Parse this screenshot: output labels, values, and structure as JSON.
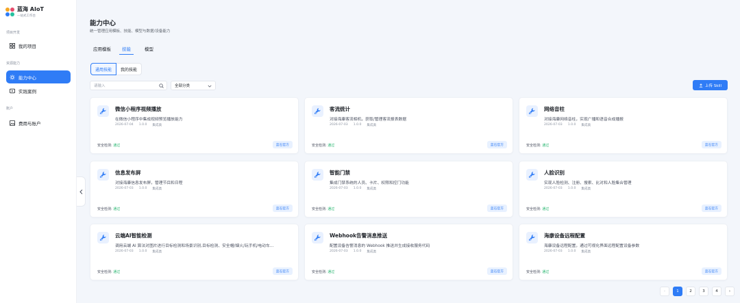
{
  "brand": {
    "name": "蓝海 AIoT",
    "subtitle": "一站式工作台"
  },
  "sidebar": {
    "groups": [
      {
        "title": "项目开发",
        "items": [
          {
            "label": "我的项目",
            "icon": "grid-icon"
          }
        ]
      },
      {
        "title": "资源能力",
        "items": [
          {
            "label": "能力中心",
            "icon": "gear-icon",
            "active": true
          },
          {
            "label": "实践案例",
            "icon": "play-icon"
          }
        ]
      },
      {
        "title": "账户",
        "items": [
          {
            "label": "费用与账户",
            "icon": "image-icon"
          }
        ]
      }
    ]
  },
  "page": {
    "title": "能力中心",
    "subtitle": "统一管理应用模板、技能、模型与数据/设备能力"
  },
  "tabs": [
    {
      "label": "应用模板"
    },
    {
      "label": "技能",
      "active": true
    },
    {
      "label": "模型"
    }
  ],
  "segments": [
    {
      "label": "通用技能",
      "active": true
    },
    {
      "label": "我的技能"
    }
  ],
  "filters": {
    "search_placeholder": "请输入",
    "category_value": "全部分类"
  },
  "upload_label": "上传 Skill",
  "card_common": {
    "check_label": "安全检测:",
    "check_status": "通过",
    "badge": "蓝石官方",
    "integrate": "集成类"
  },
  "cards": [
    {
      "title": "微信小程序视频播放",
      "desc": "在微信小程序中集成视频预览播放能力",
      "date": "2026-07-04",
      "version": "1.0.0"
    },
    {
      "title": "客流统计",
      "desc": "对接海康客流相机，获取/管理客流报表数据",
      "date": "2026-07-03",
      "version": "1.0.0"
    },
    {
      "title": "网络音柱",
      "desc": "对接海康网络音柱，实现广播和语音合成播报",
      "date": "2026-07-03",
      "version": "1.0.0"
    },
    {
      "title": "信息发布屏",
      "desc": "对接海康信息发布屏，管理节目和日程",
      "date": "2026-07-03",
      "version": "1.0.0"
    },
    {
      "title": "智能门禁",
      "desc": "集成门禁系统的人员、卡片、权限和控门功能",
      "date": "2026-07-03",
      "version": "1.0.0"
    },
    {
      "title": "人脸识别",
      "desc": "实现人脸检测、注册、搜索、比对和人脸集合管理",
      "date": "2026-07-03",
      "version": "1.0.0"
    },
    {
      "title": "云端AI智能检测",
      "desc": "调用云端 AI 算法对图片进行目标检测和场景识别,目标检测、安全帽/烟火/玩手机/电动车...",
      "date": "2026-07-03",
      "version": "1.0.0"
    },
    {
      "title": "Webhook告警消息推送",
      "desc": "配置设备告警消息的 Webhook 推送并生成接收服务代码",
      "date": "2026-07-03",
      "version": "1.0.0"
    },
    {
      "title": "海康设备远程配置",
      "desc": "海康设备远程配置，通过可视化界面远程配置设备参数",
      "date": "2026-07-03",
      "version": "1.0.0"
    }
  ],
  "pagination": {
    "prev": "‹",
    "next": "›",
    "pages": [
      "1",
      "2",
      "3",
      "4"
    ],
    "current": "1"
  },
  "colors": {
    "accent": "#2f7cf6",
    "pass": "#21b36b"
  }
}
